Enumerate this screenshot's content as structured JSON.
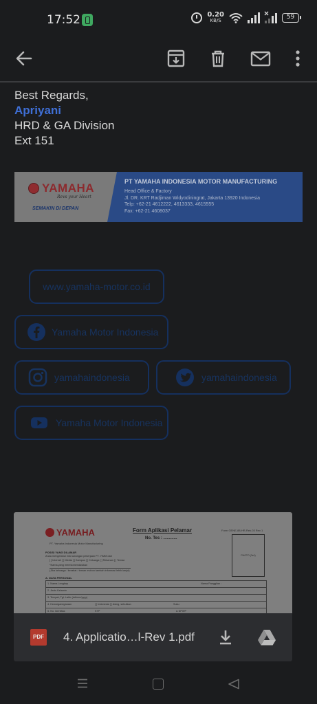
{
  "status_bar": {
    "time": "17:52",
    "net_speed": "0.20",
    "net_unit": "KB/S",
    "battery": "59"
  },
  "email": {
    "signature": {
      "closing": "Best Regards,",
      "name": "Apriyani",
      "department": "HRD & GA Division",
      "ext": "Ext 151"
    },
    "banner": {
      "brand": "YAMAHA",
      "tagline": "Revs your Heart",
      "slogan": "SEMAKIN DI DEPAN",
      "company": "PT YAMAHA INDONESIA MOTOR MANUFACTURING",
      "office": "Head Office & Factory",
      "address": "Jl. DR. KRT Radjiman Widyodiningrat, Jakarta 13920 Indonesia",
      "telp": "Telp: +62-21 4612222, 4613333, 4615555",
      "fax": "Fax: +62-21 4608037"
    },
    "social": {
      "website": "www.yamaha-motor.co.id",
      "facebook": "Yamaha Motor Indonesia",
      "instagram": "yamahaindonesia",
      "twitter": "yamahaindonesia",
      "youtube": "Yamaha Motor Indonesia"
    }
  },
  "attachment": {
    "form": {
      "brand": "YAMAHA",
      "company": "PT. Yamaha Indonesia Motor Manufacturing",
      "title": "Form Aplikasi Pelamar",
      "test_no": "No. Tes : ............",
      "code": "Form GENE-88-HR-Rek.03   Rev 1",
      "photo": "PHOTO (3x4)",
      "section_position": "POSISI YANG DILAMAR",
      "info_line": "Anda mengetahui info lowongan pekerjaan PT. YIMM dari",
      "options": "[ ] Internet   [ ] Media   [ ] Kampus   [ ] Keluarga   [ ] Rekanan   [ ] Teman",
      "referrer": "*Nama yang merekomendasikan",
      "fill_note": "(Jika keluarga / kerabat / teman mohon tambah informasi lebih lanjut)",
      "section_personal": "A. DATA PERSONAL",
      "rows": [
        "1. Nama Lengkap",
        "2. Jenis Kelamin",
        "3. Tempat, Tgl. Lahir (dd/mm/yyyy)",
        "4. Kewarganegaraan",
        "5. No. Identitas"
      ],
      "nickname": "Nama Panggilan :",
      "citizen_opts": "[ ] Indonesia   [ ] Asing, sebutkan",
      "ethnic": "Suku",
      "ktp": "KTP",
      "npwp": "& NPWP"
    },
    "file_name": "4. Applicatio…l-Rev 1.pdf",
    "file_type": "PDF"
  }
}
